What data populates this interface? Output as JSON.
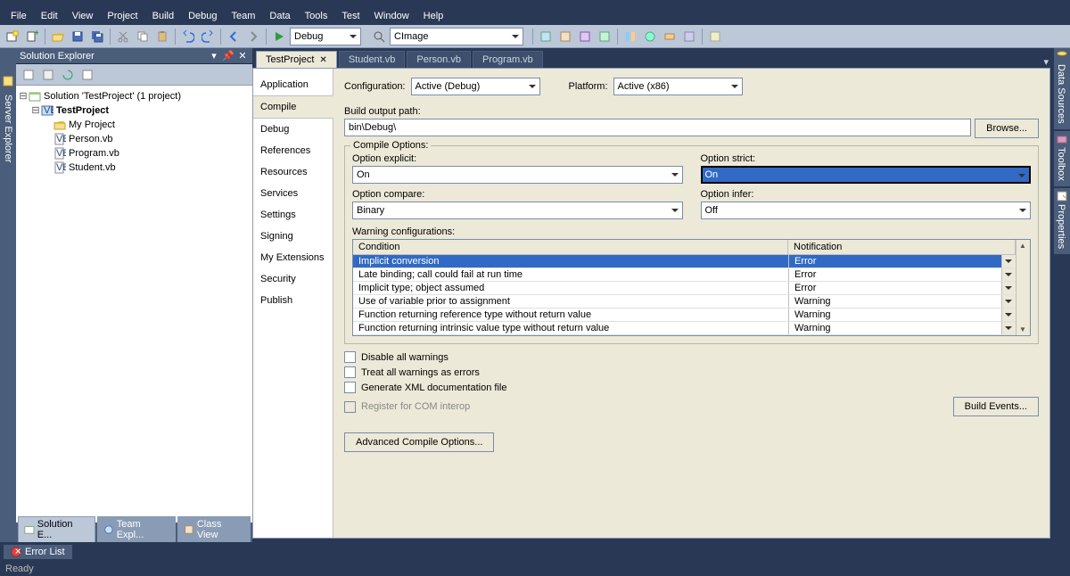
{
  "menus": [
    "File",
    "Edit",
    "View",
    "Project",
    "Build",
    "Debug",
    "Team",
    "Data",
    "Tools",
    "Test",
    "Window",
    "Help"
  ],
  "toolbar": {
    "config_combo": "Debug",
    "find_combo": "CImage"
  },
  "solution_explorer": {
    "title": "Solution Explorer",
    "solution_label": "Solution 'TestProject' (1 project)",
    "project_label": "TestProject",
    "items": [
      "My Project",
      "Person.vb",
      "Program.vb",
      "Student.vb"
    ],
    "tabs": [
      "Solution E...",
      "Team Expl...",
      "Class View"
    ]
  },
  "left_tab": "Server Explorer",
  "doc_tabs": [
    "TestProject",
    "Student.vb",
    "Person.vb",
    "Program.vb"
  ],
  "props_nav": [
    "Application",
    "Compile",
    "Debug",
    "References",
    "Resources",
    "Services",
    "Settings",
    "Signing",
    "My Extensions",
    "Security",
    "Publish"
  ],
  "props_nav_active": "Compile",
  "config": {
    "configuration_label": "Configuration:",
    "configuration_value": "Active (Debug)",
    "platform_label": "Platform:",
    "platform_value": "Active (x86)"
  },
  "build_output": {
    "label": "Build output path:",
    "value": "bin\\Debug\\",
    "browse": "Browse..."
  },
  "compile_options_title": "Compile Options:",
  "options": {
    "explicit_label": "Option explicit:",
    "explicit_value": "On",
    "strict_label": "Option strict:",
    "strict_value": "On",
    "compare_label": "Option compare:",
    "compare_value": "Binary",
    "infer_label": "Option infer:",
    "infer_value": "Off"
  },
  "warnings": {
    "label": "Warning configurations:",
    "header_condition": "Condition",
    "header_notification": "Notification",
    "rows": [
      {
        "cond": "Implicit conversion",
        "notif": "Error",
        "selected": true
      },
      {
        "cond": "Late binding; call could fail at run time",
        "notif": "Error"
      },
      {
        "cond": "Implicit type; object assumed",
        "notif": "Error"
      },
      {
        "cond": "Use of variable prior to assignment",
        "notif": "Warning"
      },
      {
        "cond": "Function returning reference type without return value",
        "notif": "Warning"
      },
      {
        "cond": "Function returning intrinsic value type without return value",
        "notif": "Warning"
      }
    ]
  },
  "checks": {
    "disable_all": "Disable all warnings",
    "treat_errors": "Treat all warnings as errors",
    "gen_xml": "Generate XML documentation file",
    "register_com": "Register for COM interop"
  },
  "buttons": {
    "build_events": "Build Events...",
    "advanced": "Advanced Compile Options..."
  },
  "right_tabs": [
    "Data Sources",
    "Toolbox",
    "Properties"
  ],
  "bottom_tab": "Error List",
  "status": "Ready"
}
